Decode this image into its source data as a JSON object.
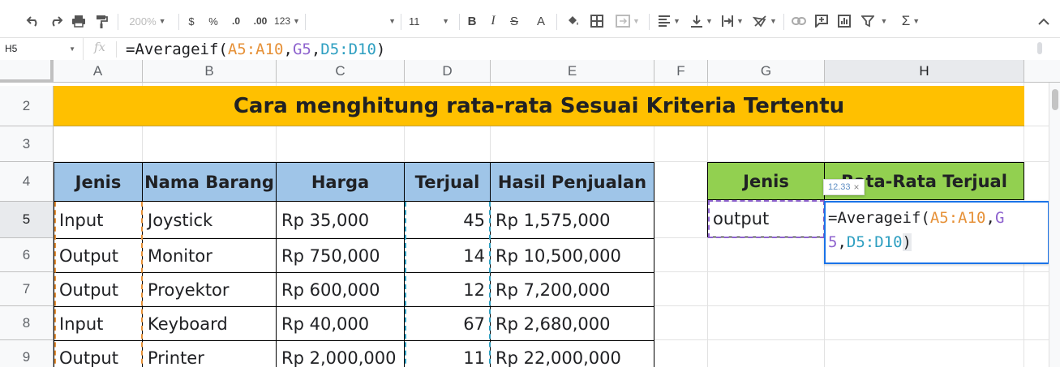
{
  "toolbar": {
    "zoom": "200%",
    "currency": "$",
    "percent": "%",
    "decrease_decimal": ".0",
    "increase_decimal": ".00",
    "more_formats": "123",
    "font_name": "",
    "font_size": "11",
    "bold": "B",
    "italic": "I",
    "strikethrough": "S",
    "text_color": "A"
  },
  "formula_bar": {
    "name_box": "H5",
    "fx": "fx",
    "formula": {
      "prefix": "=Averageif(",
      "range1": "A5:A10",
      "comma1": ",",
      "criterion": "G5",
      "comma2": ",",
      "range2": "D5:D10",
      "suffix": ")"
    }
  },
  "columns": [
    "A",
    "B",
    "C",
    "D",
    "E",
    "F",
    "G",
    "H"
  ],
  "rows": [
    "2",
    "3",
    "4",
    "5",
    "6",
    "7",
    "8",
    "9"
  ],
  "sheet": {
    "title": "Cara menghitung rata-rata Sesuai Kriteria Tertentu",
    "headers": [
      "Jenis",
      "Nama Barang",
      "Harga",
      "Terjual",
      "Hasil Penjualan"
    ],
    "data": [
      [
        "Input",
        "Joystick",
        "Rp 35,000",
        "45",
        "Rp 1,575,000"
      ],
      [
        "Output",
        "Monitor",
        "Rp 750,000",
        "14",
        "Rp 10,500,000"
      ],
      [
        "Output",
        "Proyektor",
        "Rp 600,000",
        "12",
        "Rp 7,200,000"
      ],
      [
        "Input",
        "Keyboard",
        "Rp 40,000",
        "67",
        "Rp 2,680,000"
      ],
      [
        "Output",
        "Printer",
        "Rp 2,000,000",
        "11",
        "Rp 22,000,000"
      ]
    ],
    "side_headers": [
      "Jenis",
      "Rata-Rata Terjual"
    ],
    "criterion_value": "output"
  },
  "editor": {
    "preview": "12.33",
    "close": "×",
    "line1_prefix": "=Averageif(",
    "line1_range": "A5:A10",
    "line1_comma": ",",
    "line1_crit": "G",
    "line2_crit": "5",
    "line2_comma": ",",
    "line2_range": "D5:D10",
    "line2_suffix": ")"
  },
  "colors": {
    "title_fill": "#ffc000",
    "header_fill": "#9fc5e8",
    "side_header_fill": "#92d050",
    "active_border": "#1a73e8",
    "range_a": "#e69138",
    "range_g": "#8e63ce",
    "range_d": "#2e9fc1"
  }
}
